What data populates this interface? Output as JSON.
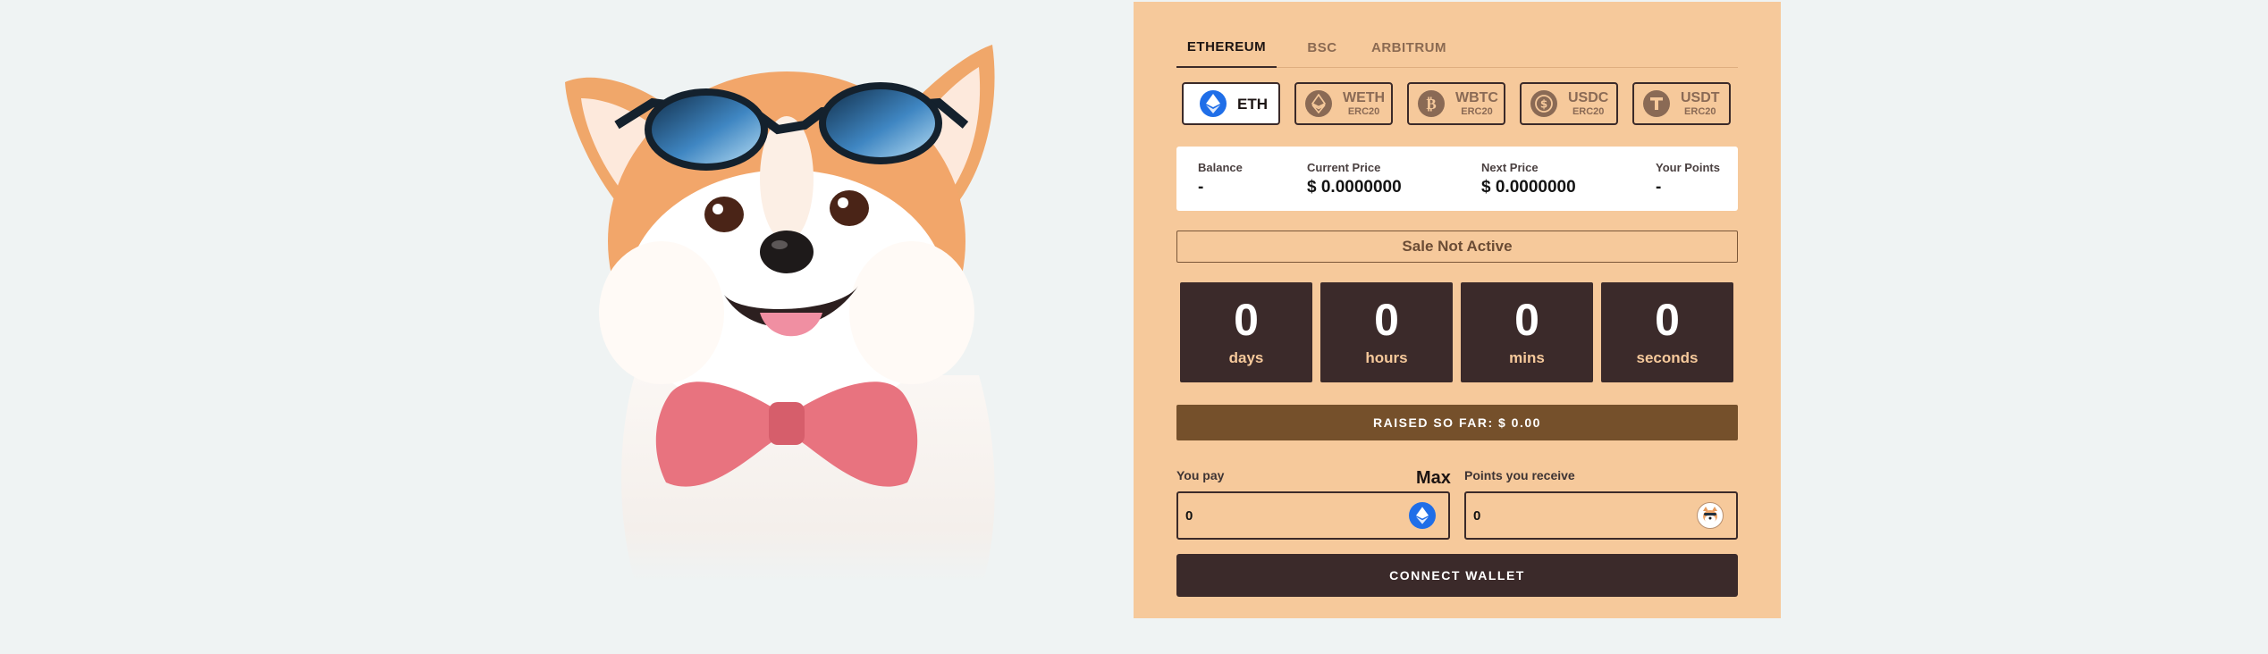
{
  "network_tabs": [
    {
      "label": "ETHEREUM",
      "active": true
    },
    {
      "label": "BSC",
      "active": false
    },
    {
      "label": "ARBITRUM",
      "active": false
    }
  ],
  "tokens": [
    {
      "name": "ETH",
      "standard": "",
      "icon": "eth-icon",
      "active": true
    },
    {
      "name": "WETH",
      "standard": "ERC20",
      "icon": "weth-icon",
      "active": false
    },
    {
      "name": "WBTC",
      "standard": "ERC20",
      "icon": "wbtc-icon",
      "active": false
    },
    {
      "name": "USDC",
      "standard": "ERC20",
      "icon": "usdc-icon",
      "active": false
    },
    {
      "name": "USDT",
      "standard": "ERC20",
      "icon": "usdt-icon",
      "active": false
    }
  ],
  "stats": {
    "balance": {
      "label": "Balance",
      "value": "-"
    },
    "current_price": {
      "label": "Current Price",
      "value": "$ 0.0000000"
    },
    "next_price": {
      "label": "Next Price",
      "value": "$ 0.0000000"
    },
    "your_points": {
      "label": "Your Points",
      "value": "-"
    }
  },
  "sale_status": "Sale Not Active",
  "countdown": [
    {
      "value": "0",
      "unit": "days"
    },
    {
      "value": "0",
      "unit": "hours"
    },
    {
      "value": "0",
      "unit": "mins"
    },
    {
      "value": "0",
      "unit": "seconds"
    }
  ],
  "raised": "RAISED SO FAR: $ 0.00",
  "pay": {
    "label": "You pay",
    "max_label": "Max",
    "value": "0",
    "icon": "eth-icon"
  },
  "receive": {
    "label": "Points you receive",
    "value": "0",
    "icon": "shiba-token-icon"
  },
  "connect_button": "CONNECT WALLET",
  "colors": {
    "page_bg": "#eff3f3",
    "panel_bg": "#f6c99b",
    "dark_brown": "#3b2a2a",
    "raised_bar": "#75502b",
    "eth_blue": "#1f6ee8",
    "token_inactive": "#8a6a55"
  }
}
